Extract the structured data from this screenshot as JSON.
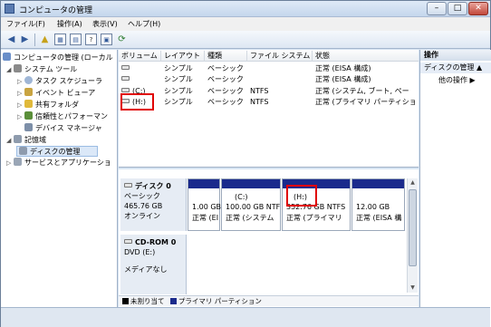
{
  "window": {
    "title": "コンピュータの管理"
  },
  "controls": {
    "minimize": "–",
    "maximize": "□",
    "close": "✕"
  },
  "menu": [
    "ファイル(F)",
    "操作(A)",
    "表示(V)",
    "ヘルプ(H)"
  ],
  "tree": {
    "root": "コンピュータの管理 (ローカル",
    "system_tools": "システム ツール",
    "task_scheduler": "タスク スケジューラ",
    "event_viewer": "イベント ビューア",
    "shared_folders": "共有フォルダ",
    "reliability": "信頼性とパフォーマン",
    "device_manager": "デバイス マネージャ",
    "storage": "記憶域",
    "disk_management": "ディスクの管理",
    "services": "サービスとアプリケーショ"
  },
  "list": {
    "columns": [
      "ボリューム",
      "レイアウト",
      "種類",
      "ファイル システム",
      "状態"
    ],
    "rows": [
      {
        "volume": "",
        "layout": "シンプル",
        "type": "ベーシック",
        "fs": "",
        "status": "正常 (EISA 構成)"
      },
      {
        "volume": "",
        "layout": "シンプル",
        "type": "ベーシック",
        "fs": "",
        "status": "正常 (EISA 構成)"
      },
      {
        "volume": "(C:)",
        "layout": "シンプル",
        "type": "ベーシック",
        "fs": "NTFS",
        "status": "正常 (システム, ブート, ペー"
      },
      {
        "volume": "(H:)",
        "layout": "シンプル",
        "type": "ベーシック",
        "fs": "NTFS",
        "status": "正常 (プライマリ パーティショ"
      }
    ]
  },
  "disk0": {
    "name": "ディスク 0",
    "type": "ベーシック",
    "size": "465.76 GB",
    "status": "オンライン",
    "partitions": [
      {
        "label": "",
        "size": "1.00 GB",
        "status": "正常 (EI",
        "color": "#1a2a8c"
      },
      {
        "label": "(C:)",
        "size": "100.00 GB NTF",
        "status": "正常 (システム",
        "color": "#1a2a8c"
      },
      {
        "label": "(H:)",
        "size": "352.76 GB NTFS",
        "status": "正常 (プライマリ",
        "color": "#1a2a8c"
      },
      {
        "label": "",
        "size": "12.00 GB",
        "status": "正常 (EISA 構",
        "color": "#1a2a8c"
      }
    ]
  },
  "cdrom0": {
    "name": "CD-ROM 0",
    "drive": "DVD (E:)",
    "media": "メディアなし"
  },
  "legend": {
    "unallocated": "未割り当て",
    "primary": "プライマリ パーティション",
    "unallocated_color": "#000000",
    "primary_color": "#1a2a8c"
  },
  "actions": {
    "header": "操作",
    "section": "ディスクの管理",
    "other": "他の操作"
  },
  "highlight_color": "#e00000"
}
